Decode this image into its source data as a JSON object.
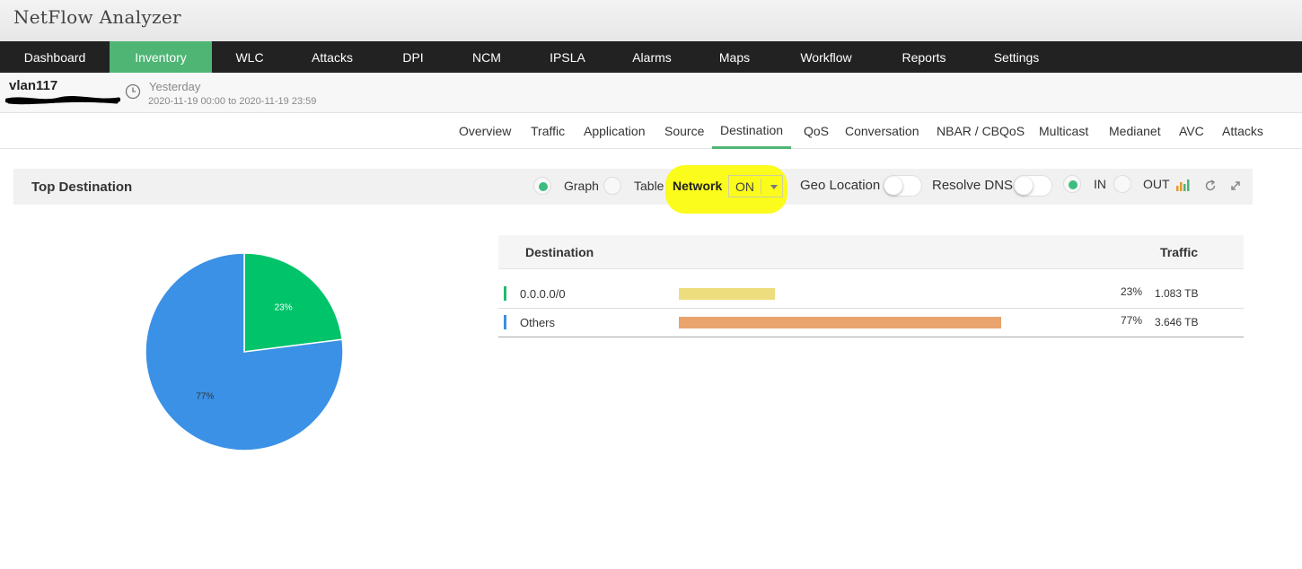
{
  "app": {
    "title": "NetFlow Analyzer"
  },
  "nav": {
    "items": [
      {
        "label": "Dashboard",
        "active": false
      },
      {
        "label": "Inventory",
        "active": true
      },
      {
        "label": "WLC",
        "active": false
      },
      {
        "label": "Attacks",
        "active": false
      },
      {
        "label": "DPI",
        "active": false
      },
      {
        "label": "NCM",
        "active": false
      },
      {
        "label": "IPSLA",
        "active": false
      },
      {
        "label": "Alarms",
        "active": false
      },
      {
        "label": "Maps",
        "active": false
      },
      {
        "label": "Workflow",
        "active": false
      },
      {
        "label": "Reports",
        "active": false
      },
      {
        "label": "Settings",
        "active": false
      }
    ]
  },
  "device": {
    "name": "vlan117",
    "period_label": "Yesterday",
    "period_range": "2020-11-19 00:00 to 2020-11-19 23:59"
  },
  "tabs": [
    {
      "label": "Overview"
    },
    {
      "label": "Traffic"
    },
    {
      "label": "Application"
    },
    {
      "label": "Source"
    },
    {
      "label": "Destination",
      "active": true
    },
    {
      "label": "QoS"
    },
    {
      "label": "Conversation"
    },
    {
      "label": "NBAR / CBQoS"
    },
    {
      "label": "Multicast"
    },
    {
      "label": "Medianet"
    },
    {
      "label": "AVC"
    },
    {
      "label": "Attacks"
    }
  ],
  "panel": {
    "title": "Top Destination",
    "graph_label": "Graph",
    "table_label": "Table",
    "view_selected": "Graph",
    "network_label": "Network",
    "network_value": "ON",
    "geo_label": "Geo Location",
    "geo_on": false,
    "dns_label": "Resolve DNS",
    "dns_on": false,
    "in_label": "IN",
    "out_label": "OUT",
    "direction_selected": "IN"
  },
  "table": {
    "header_destination": "Destination",
    "header_traffic": "Traffic",
    "rows": [
      {
        "destination": "0.0.0.0/0",
        "percent": "23%",
        "volume": "1.083 TB",
        "share": 0.23,
        "bar_color": "#eedd7d",
        "marker_color": "#1fba6d"
      },
      {
        "destination": "Others",
        "percent": "77%",
        "volume": "3.646 TB",
        "share": 0.77,
        "bar_color": "#e9a36d",
        "marker_color": "#3a8fe0"
      }
    ]
  },
  "chart_data": {
    "type": "pie",
    "slices": [
      {
        "label": "23%",
        "value": 23,
        "color": "#00c36a"
      },
      {
        "label": "77%",
        "value": 77,
        "color": "#3b91e6"
      }
    ]
  },
  "colors": {
    "nav_active": "#4fb575",
    "nav_bg": "#222222",
    "highlight": "#fbfb1c",
    "radio_on": "#3dbd7d"
  },
  "icons": {
    "clock": "clock-icon",
    "chart": "bar-chart-icon",
    "refresh": "refresh-icon",
    "expand": "expand-icon"
  }
}
